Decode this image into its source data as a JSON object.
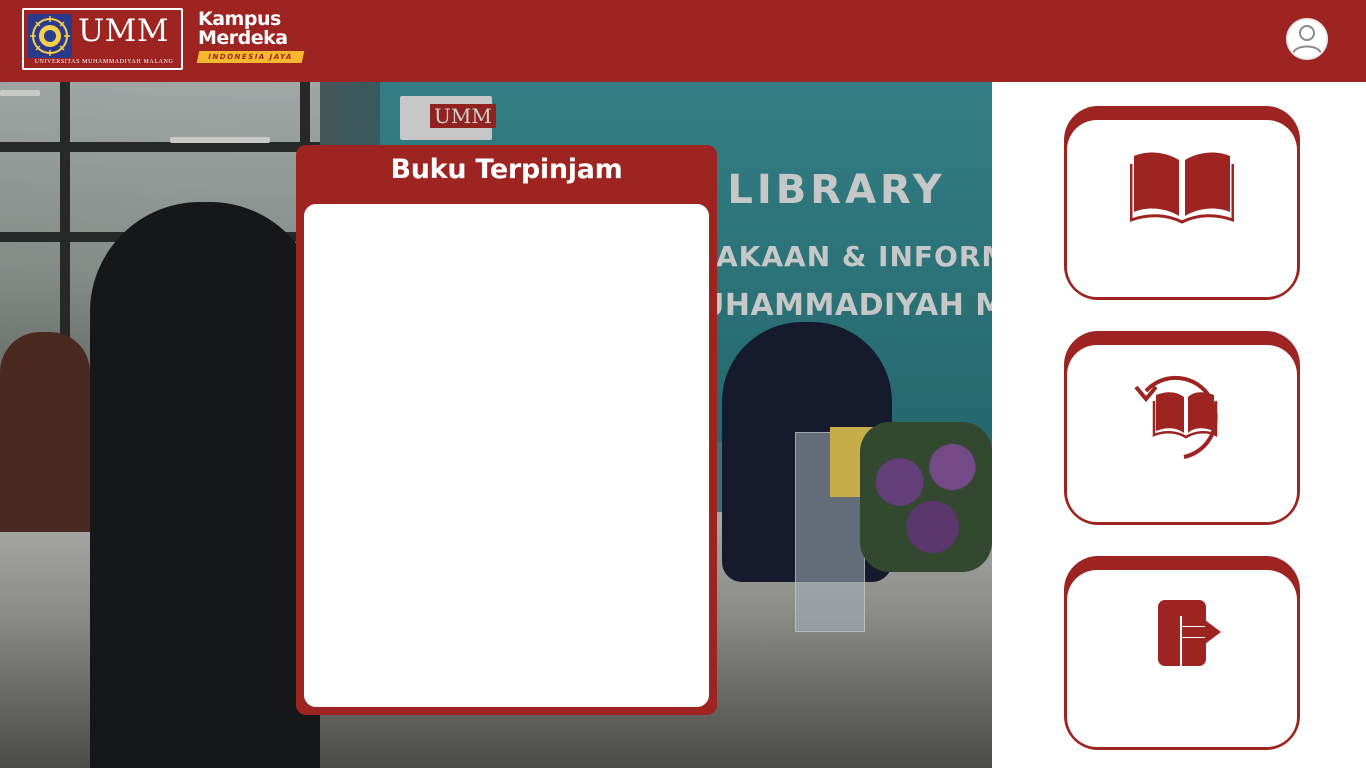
{
  "header": {
    "umm_logo": {
      "wordmark": "UMM",
      "subtitle": "UNIVERSITAS MUHAMMADIYAH MALANG"
    },
    "kampus_merdeka_logo": {
      "line1": "Kampus",
      "line2": "Merdeka",
      "ribbon": "INDONESIA JAYA"
    },
    "profile_icon": "user-avatar-icon"
  },
  "background_photo": {
    "banner_lines": [
      "L LIBRARY",
      "AKAAN & INFORM",
      "UHAMMADIYAH MA"
    ],
    "sign": "UMM"
  },
  "borrowed_panel": {
    "title": "Buku Terpinjam",
    "items": []
  },
  "menu": [
    {
      "id": "books",
      "icon": "open-book-icon"
    },
    {
      "id": "return",
      "icon": "book-return-icon"
    },
    {
      "id": "logout",
      "icon": "logout-door-icon"
    }
  ],
  "colors": {
    "primary": "#9e2421",
    "surface": "#ffffff",
    "ribbon": "#f5b82e"
  }
}
